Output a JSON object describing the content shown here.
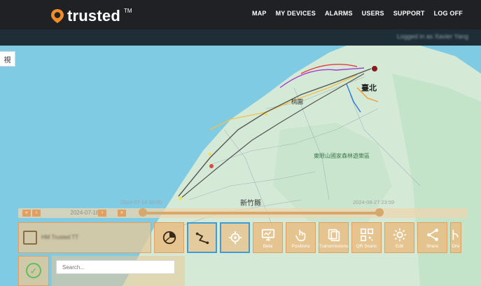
{
  "brand": {
    "name": "trusted",
    "tm": "TM",
    "accent": "#f28c28"
  },
  "nav": [
    {
      "label": "MAP"
    },
    {
      "label": "MY DEVICES"
    },
    {
      "label": "ALARMS"
    },
    {
      "label": "USERS"
    },
    {
      "label": "SUPPORT"
    },
    {
      "label": "LOG OFF"
    }
  ],
  "subbar": {
    "logged_in_text": "Logged in as Xavier Yang"
  },
  "map": {
    "side_tab_label": "視",
    "labels": {
      "taipei": "臺北",
      "hsinchu_county": "新竹縣",
      "taoyuan": "桃園",
      "forest_park": "東眼山國家森林遊樂區"
    }
  },
  "timeline": {
    "first_label": "«",
    "prev_label": "‹",
    "next_label": "›",
    "last_label": "»",
    "date": "2024-07-18",
    "start_time": "2024-07-18 00:00",
    "end_time": "2024-08-27 23:59"
  },
  "device_card": {
    "name": "HM Trusted TT"
  },
  "actions": [
    {
      "label": "",
      "icon": "pie-chart-icon",
      "active": false
    },
    {
      "label": "",
      "icon": "route-icon",
      "active": true
    },
    {
      "label": "",
      "icon": "crosshair-icon",
      "active": true
    },
    {
      "label": "Beta",
      "icon": "monitor-icon",
      "active": false
    },
    {
      "label": "Positions",
      "icon": "touch-icon",
      "active": false
    },
    {
      "label": "Transmissions",
      "icon": "layers-icon",
      "active": false
    },
    {
      "label": "QR Scans",
      "icon": "qr-code-icon",
      "active": false
    },
    {
      "label": "Edit",
      "icon": "gear-icon",
      "active": false
    },
    {
      "label": "Share",
      "icon": "share-icon",
      "active": false
    },
    {
      "label": "Driv",
      "icon": "branch-icon",
      "active": false
    }
  ],
  "search": {
    "placeholder": "Search..."
  },
  "colors": {
    "route_line": "#555555",
    "panel_orange": "#e1a060",
    "map_water": "#7fcbe3",
    "map_land": "#cfe7d5"
  }
}
